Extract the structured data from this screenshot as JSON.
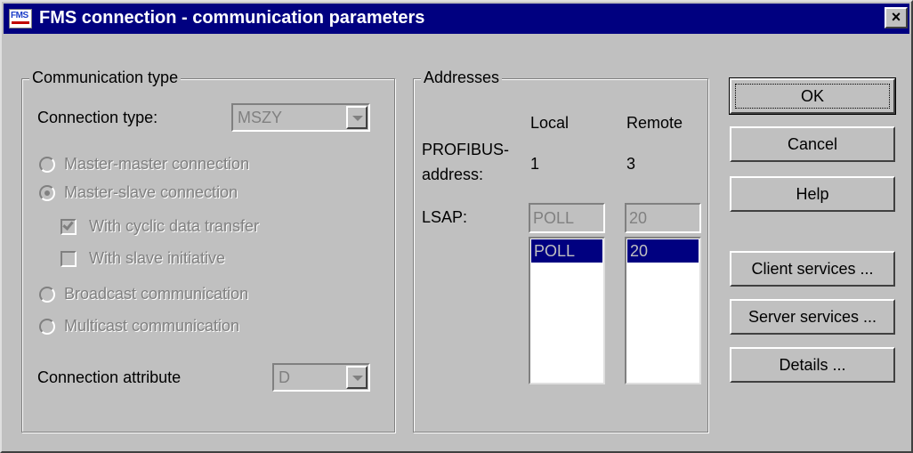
{
  "window": {
    "title": "FMS connection - communication parameters",
    "icon_text": "FMS",
    "close_glyph": "×"
  },
  "comm_type": {
    "legend": "Communication type",
    "connection_type_label": "Connection type:",
    "connection_type_value": "MSZY",
    "options": [
      {
        "label": "Master-master connection",
        "selected": false
      },
      {
        "label": "Master-slave connection",
        "selected": true
      },
      {
        "label": "Broadcast communication",
        "selected": false
      },
      {
        "label": "Multicast communication",
        "selected": false
      }
    ],
    "checks": [
      {
        "label": "With cyclic data transfer",
        "checked": true
      },
      {
        "label": "With slave initiative",
        "checked": false
      }
    ],
    "attribute_label": "Connection attribute",
    "attribute_value": "D"
  },
  "addresses": {
    "legend": "Addresses",
    "local_header": "Local",
    "remote_header": "Remote",
    "profibus_label_line1": "PROFIBUS-",
    "profibus_label_line2": "address:",
    "local_address": "1",
    "remote_address": "3",
    "lsap_label": "LSAP:",
    "local_lsap": "POLL",
    "remote_lsap": "20",
    "local_list_selected": "POLL",
    "remote_list_selected": "20"
  },
  "buttons": {
    "ok": "OK",
    "cancel": "Cancel",
    "help": "Help",
    "client_services": "Client services ...",
    "server_services": "Server services ...",
    "details": "Details ..."
  },
  "colors": {
    "titlebar": "#000080",
    "face": "#c0c0c0",
    "selection": "#000080",
    "disabled_text": "#808080"
  }
}
